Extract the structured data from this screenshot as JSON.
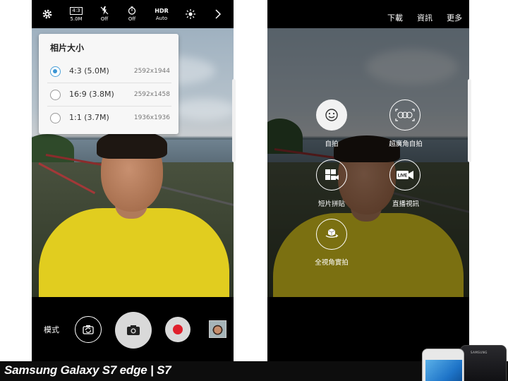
{
  "left_screen": {
    "topbar": {
      "settings_icon": "gear-icon",
      "picture_size_badge": "4:3",
      "picture_size_value": "5.0M",
      "flash_label": "Off",
      "timer_label": "Off",
      "hdr_title": "HDR",
      "hdr_label": "Auto",
      "filter_icon": "filter-icon",
      "more_icon": "chevron-right-icon"
    },
    "popup": {
      "title": "相片大小",
      "options": [
        {
          "label": "4:3 (5.0M)",
          "resolution": "2592x1944",
          "selected": true
        },
        {
          "label": "16:9 (3.8M)",
          "resolution": "2592x1458",
          "selected": false
        },
        {
          "label": "1:1 (3.7M)",
          "resolution": "1936x1936",
          "selected": false
        }
      ]
    },
    "bottom": {
      "mode_label": "模式"
    }
  },
  "right_screen": {
    "topbar": {
      "download": "下載",
      "info": "資訊",
      "more": "更多"
    },
    "modes": [
      {
        "label": "自拍",
        "icon": "smiley-icon"
      },
      {
        "label": "超廣角自拍",
        "icon": "wide-selfie-icon"
      },
      {
        "label": "短片拼貼",
        "icon": "video-collage-icon"
      },
      {
        "label": "直播視訊",
        "icon": "live-broadcast-icon"
      },
      {
        "label": "全視角實拍",
        "icon": "panorama-360-icon"
      }
    ],
    "live_badge": "LIVE"
  },
  "caption": {
    "text": "Samsung Galaxy S7 edge | S7"
  },
  "device": {
    "brand": "SAMSUNG"
  }
}
